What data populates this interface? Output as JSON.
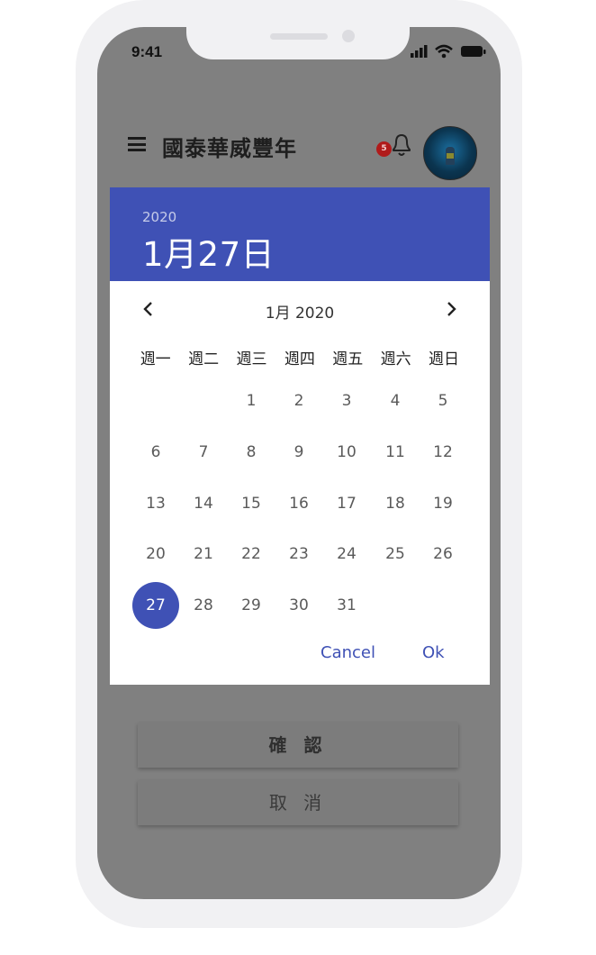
{
  "status_bar": {
    "time": "9:41"
  },
  "app_bar": {
    "title": "國泰華威豐年",
    "notification_count": "5"
  },
  "date_picker": {
    "header_year": "2020",
    "header_date": "1月27日",
    "month_label": "1月 2020",
    "weekdays": [
      "週一",
      "週二",
      "週三",
      "週四",
      "週五",
      "週六",
      "週日"
    ],
    "days": [
      "1",
      "2",
      "3",
      "4",
      "5",
      "6",
      "7",
      "8",
      "9",
      "10",
      "11",
      "12",
      "13",
      "14",
      "15",
      "16",
      "17",
      "18",
      "19",
      "20",
      "21",
      "22",
      "23",
      "24",
      "25",
      "26",
      "27",
      "28",
      "29",
      "30",
      "31"
    ],
    "first_weekday_index": 2,
    "selected_day": "27",
    "cancel_label": "Cancel",
    "ok_label": "Ok",
    "accent_color": "#3f51b5"
  },
  "actions": {
    "confirm_label": "確 認",
    "cancel_label": "取 消"
  }
}
